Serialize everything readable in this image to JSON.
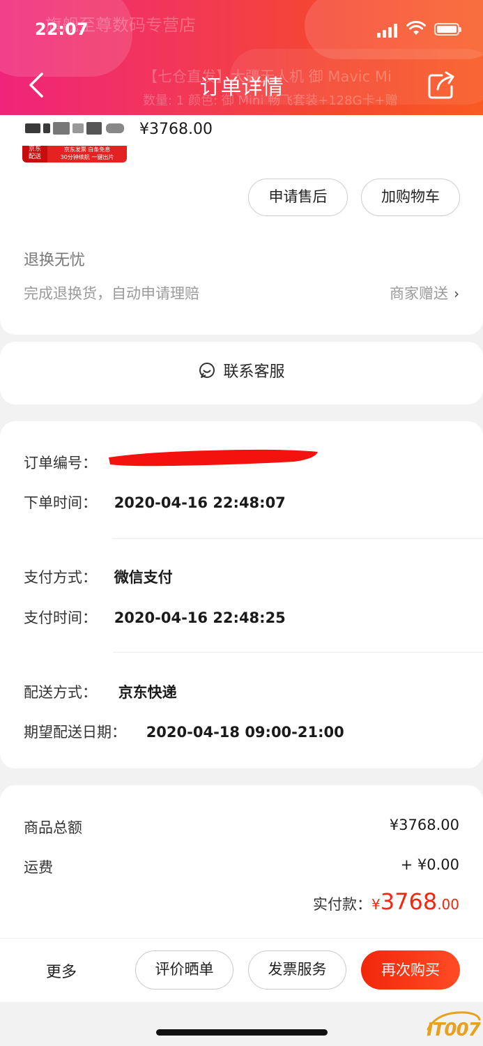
{
  "status_bar": {
    "time": "22:07"
  },
  "header": {
    "title": "订单详情",
    "ghost_store": "旗舰至尊数码专营店",
    "ghost_product": "【七仓直发】大疆无人机 御 Mavic Mi",
    "ghost_qty": "数量: 1  颜色: 御 Mini 畅飞套装+128G卡+赠"
  },
  "product": {
    "price": "¥3768.00",
    "thumb_tag": "京东\n配送",
    "thumb_band": "京东发票 白条免息\n30分钟续航 一键出片",
    "buttons": {
      "after_sale": "申请售后",
      "add_cart": "加购物车"
    },
    "guarantee": {
      "title": "退换无忧",
      "desc": "完成退换货，自动申请理赔",
      "right": "商家赠送",
      "chevron": "›"
    }
  },
  "contact": {
    "label": "联系客服"
  },
  "order_info": {
    "order_no_label": "订单编号：",
    "order_time_label": "下单时间：",
    "order_time": "2020-04-16 22:48:07",
    "pay_method_label": "支付方式：",
    "pay_method": "微信支付",
    "pay_time_label": "支付时间：",
    "pay_time": "2020-04-16 22:48:25",
    "delivery_method_label": "配送方式：",
    "delivery_method": "京东快递",
    "expected_date_label": "期望配送日期：",
    "expected_date": "2020-04-18 09:00-21:00"
  },
  "amounts": {
    "goods_total_label": "商品总额",
    "goods_total": "¥3768.00",
    "shipping_label": "运费",
    "shipping": "+ ¥0.00",
    "paid_label": "实付款：",
    "paid_currency": "¥",
    "paid_integer": "3768",
    "paid_decimal": ".00"
  },
  "bottom_bar": {
    "more": "更多",
    "review": "评价晒单",
    "invoice": "发票服务",
    "rebuy": "再次购买"
  },
  "watermark": "IT007",
  "colors": {
    "accent": "#f2270c",
    "header_start": "#f0247a",
    "header_end": "#f95a22"
  }
}
